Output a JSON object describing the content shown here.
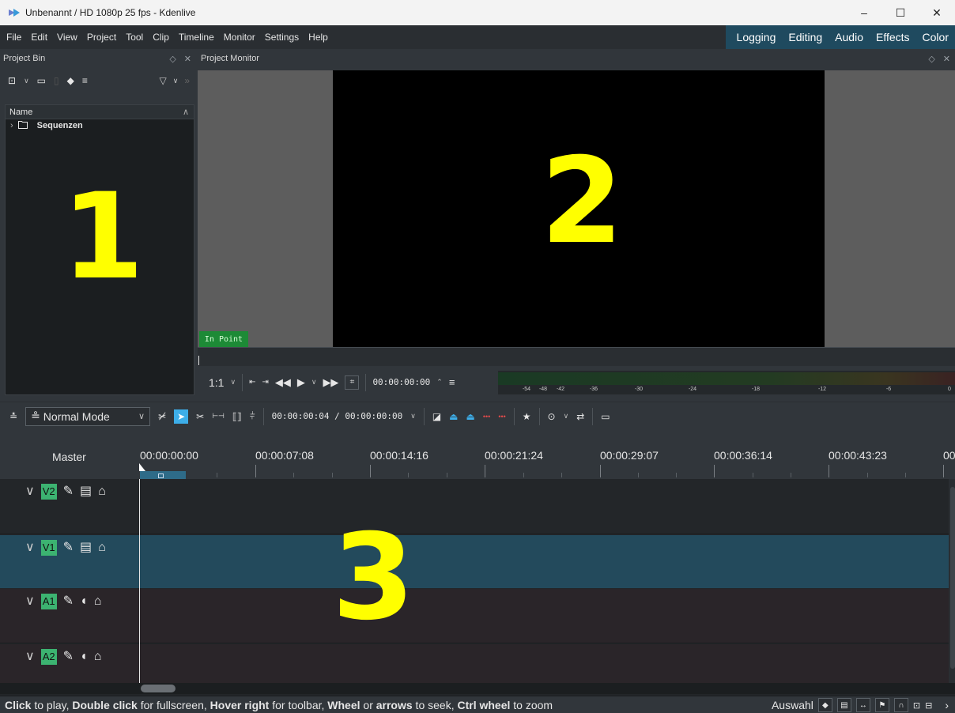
{
  "window": {
    "title": "Unbenannt / HD 1080p 25 fps - Kdenlive",
    "controls": {
      "minimize": "–",
      "maximize": "☐",
      "close": "✕"
    }
  },
  "menu": [
    "File",
    "Edit",
    "View",
    "Project",
    "Tool",
    "Clip",
    "Timeline",
    "Monitor",
    "Settings",
    "Help"
  ],
  "layouts": [
    "Logging",
    "Editing",
    "Audio",
    "Effects",
    "Color"
  ],
  "project_bin": {
    "title": "Project Bin",
    "column_header": "Name",
    "items": [
      {
        "name": "Sequenzen",
        "type": "folder"
      }
    ]
  },
  "project_monitor": {
    "title": "Project Monitor",
    "in_point_label": "In Point",
    "zoom": "1:1",
    "timecode": "00:00:00:00",
    "meter_labels": [
      "-54",
      "-48",
      "-42",
      "-36",
      "-30",
      "-24",
      "-18",
      "-12",
      "-6",
      "0"
    ]
  },
  "timeline_toolbar": {
    "mode": "Normal Mode",
    "position": "00:00:00:04 / 00:00:00:00"
  },
  "timeline": {
    "master_label": "Master",
    "ruler": [
      "00:00:00:00",
      "00:00:07:08",
      "00:00:14:16",
      "00:00:21:24",
      "00:00:29:07",
      "00:00:36:14",
      "00:00:43:23",
      "00"
    ],
    "tracks": [
      {
        "name": "V2",
        "kind": "video"
      },
      {
        "name": "V1",
        "kind": "video",
        "selected": true
      },
      {
        "name": "A1",
        "kind": "audio"
      },
      {
        "name": "A2",
        "kind": "audio"
      }
    ]
  },
  "statusbar": {
    "parts": [
      {
        "b": "Click",
        "t": " to play, "
      },
      {
        "b": "Double click",
        "t": " for fullscreen, "
      },
      {
        "b": "Hover right",
        "t": " for toolbar, "
      },
      {
        "b": "Wheel",
        "t": " or "
      },
      {
        "b": "arrows",
        "t": " to seek, "
      },
      {
        "b": "Ctrl wheel",
        "t": " to zoom"
      }
    ],
    "tool_label": "Auswahl"
  },
  "overlay_numbers": [
    "1",
    "2",
    "3"
  ],
  "colors": {
    "accent": "#3daee9",
    "layout_bar": "#1f4a5f",
    "track_tag": "#3cb371",
    "selected_track": "#234a5c",
    "overlay": "#ffff00",
    "in_point": "#1d8a36"
  }
}
